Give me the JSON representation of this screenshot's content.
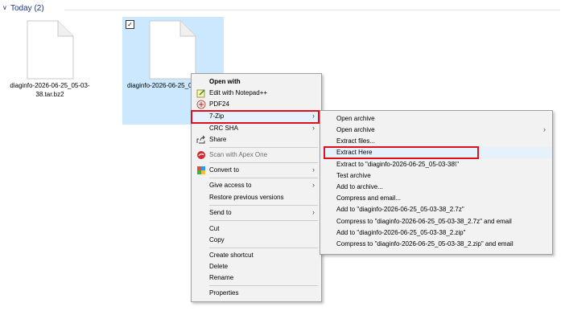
{
  "group": {
    "label": "Today (2)"
  },
  "files": [
    {
      "name": "diaginfo-2026-06-25_05-03-38.tar.bz2"
    },
    {
      "name": "diaginfo-2026-06-25_05-03-38.tar",
      "selected": true
    }
  ],
  "context_menu": {
    "items": [
      {
        "label": "Open with",
        "bold": true
      },
      {
        "label": "Edit with Notepad++",
        "icon": "notepad-icon"
      },
      {
        "label": "PDF24",
        "icon": "pdf24-icon"
      },
      {
        "label": "7-Zip",
        "submenu": true
      },
      {
        "label": "CRC SHA",
        "submenu": true
      },
      {
        "label": "Share",
        "icon": "share-icon"
      },
      {
        "label": "Scan with Apex One",
        "icon": "apex-one-icon",
        "disabled": true
      },
      {
        "label": "Convert to",
        "icon": "convert-icon",
        "submenu": true
      },
      {
        "label": "Give access to",
        "submenu": true
      },
      {
        "label": "Restore previous versions"
      },
      {
        "label": "Send to",
        "submenu": true
      },
      {
        "label": "Cut"
      },
      {
        "label": "Copy"
      },
      {
        "label": "Create shortcut"
      },
      {
        "label": "Delete"
      },
      {
        "label": "Rename"
      },
      {
        "label": "Properties"
      }
    ]
  },
  "zip_submenu": {
    "items": [
      {
        "label": "Open archive"
      },
      {
        "label": "Open archive",
        "submenu": true
      },
      {
        "label": "Extract files..."
      },
      {
        "label": "Extract Here"
      },
      {
        "label": "Extract to \"diaginfo-2026-06-25_05-03-38\\\""
      },
      {
        "label": "Test archive"
      },
      {
        "label": "Add to archive..."
      },
      {
        "label": "Compress and email..."
      },
      {
        "label": "Add to \"diaginfo-2026-06-25_05-03-38_2.7z\""
      },
      {
        "label": "Compress to \"diaginfo-2026-06-25_05-03-38_2.7z\" and email"
      },
      {
        "label": "Add to \"diaginfo-2026-06-25_05-03-38_2.zip\""
      },
      {
        "label": "Compress to \"diaginfo-2026-06-25_05-03-38_2.zip\" and email"
      }
    ]
  },
  "colors": {
    "highlight_box": "#e0101a",
    "selection": "#cce8ff",
    "group_text": "#1e3287"
  }
}
